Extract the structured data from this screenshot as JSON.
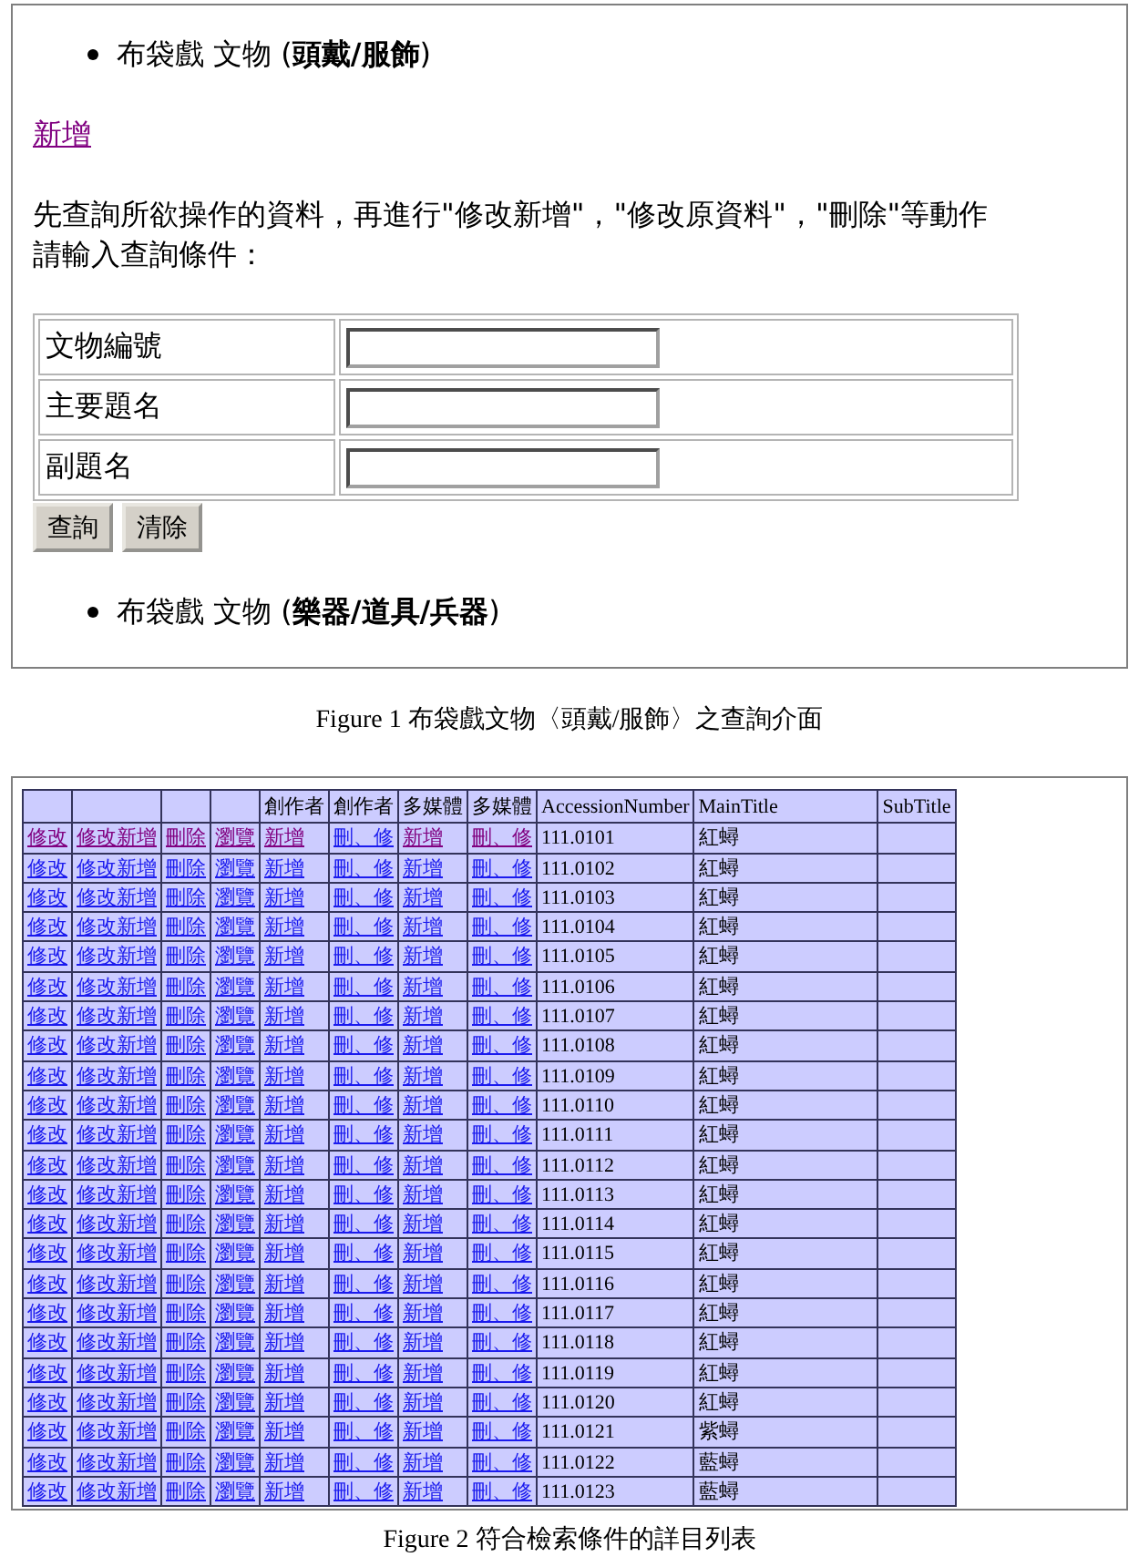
{
  "query_panel": {
    "heading": "布袋戲 文物 (**頭戴/服飾**)",
    "add_link": {
      "text": "新增",
      "visited": true
    },
    "instructions": [
      "先查詢所欲操作的資料，再進行\"修改新增\"，\"修改原資料\"，\"刪除\"等動作",
      "請輸入查詢條件："
    ],
    "fields": [
      {
        "label": "文物編號"
      },
      {
        "label": "主要題名"
      },
      {
        "label": "副題名"
      }
    ],
    "buttons": [
      "查詢",
      "清除"
    ],
    "next_heading": "布袋戲 文物 (**樂器/道具/兵器**)"
  },
  "caption_1": "Figure 1  布袋戲文物〈頭戴/服飾〉之查詢介面",
  "results_table": {
    "columns": [
      {
        "kind": "blank"
      },
      {
        "kind": "blank"
      },
      {
        "kind": "blank"
      },
      {
        "kind": "blank"
      },
      {
        "kind": "label",
        "label": "創作者"
      },
      {
        "kind": "label",
        "label": "創作者"
      },
      {
        "kind": "label",
        "label": "多媒體"
      },
      {
        "kind": "label",
        "label": "多媒體"
      },
      {
        "kind": "label",
        "label": "AccessionNumber"
      },
      {
        "kind": "label",
        "label": "MainTitle"
      },
      {
        "kind": "label",
        "label": "SubTitle"
      }
    ],
    "rows": [
      {
        "links": [
          {
            "text": "修改",
            "visited": true
          },
          {
            "text": "修改新增",
            "visited": true
          },
          {
            "text": "刪除",
            "visited": true
          },
          {
            "text": "瀏覽",
            "visited": true
          },
          {
            "text": "新增",
            "visited": true
          },
          {
            "text": "刪、修",
            "visited": false
          },
          {
            "text": "新增",
            "visited": true
          },
          {
            "text": "刪、修",
            "visited": true
          }
        ],
        "accession": "111.0101",
        "main_title": "紅蟳"
      },
      {
        "links": [
          {
            "text": "修改",
            "visited": false
          },
          {
            "text": "修改新增",
            "visited": false
          },
          {
            "text": "刪除",
            "visited": false
          },
          {
            "text": "瀏覽",
            "visited": false
          },
          {
            "text": "新增",
            "visited": false
          },
          {
            "text": "刪、修",
            "visited": false
          },
          {
            "text": "新增",
            "visited": false
          },
          {
            "text": "刪、修",
            "visited": false
          }
        ],
        "accession": "111.0102",
        "main_title": "紅蟳"
      },
      {
        "links": [
          {
            "text": "修改",
            "visited": false
          },
          {
            "text": "修改新增",
            "visited": false
          },
          {
            "text": "刪除",
            "visited": false
          },
          {
            "text": "瀏覽",
            "visited": false
          },
          {
            "text": "新增",
            "visited": false
          },
          {
            "text": "刪、修",
            "visited": false
          },
          {
            "text": "新增",
            "visited": false
          },
          {
            "text": "刪、修",
            "visited": false
          }
        ],
        "accession": "111.0103",
        "main_title": "紅蟳"
      },
      {
        "links": [
          {
            "text": "修改",
            "visited": false
          },
          {
            "text": "修改新增",
            "visited": false
          },
          {
            "text": "刪除",
            "visited": false
          },
          {
            "text": "瀏覽",
            "visited": false
          },
          {
            "text": "新增",
            "visited": false
          },
          {
            "text": "刪、修",
            "visited": false
          },
          {
            "text": "新增",
            "visited": false
          },
          {
            "text": "刪、修",
            "visited": false
          }
        ],
        "accession": "111.0104",
        "main_title": "紅蟳"
      },
      {
        "links": [
          {
            "text": "修改",
            "visited": false
          },
          {
            "text": "修改新增",
            "visited": false
          },
          {
            "text": "刪除",
            "visited": false
          },
          {
            "text": "瀏覽",
            "visited": false
          },
          {
            "text": "新增",
            "visited": false
          },
          {
            "text": "刪、修",
            "visited": false
          },
          {
            "text": "新增",
            "visited": false
          },
          {
            "text": "刪、修",
            "visited": false
          }
        ],
        "accession": "111.0105",
        "main_title": "紅蟳"
      },
      {
        "links": [
          {
            "text": "修改",
            "visited": false
          },
          {
            "text": "修改新增",
            "visited": false
          },
          {
            "text": "刪除",
            "visited": false
          },
          {
            "text": "瀏覽",
            "visited": false
          },
          {
            "text": "新增",
            "visited": false
          },
          {
            "text": "刪、修",
            "visited": false
          },
          {
            "text": "新增",
            "visited": false
          },
          {
            "text": "刪、修",
            "visited": false
          }
        ],
        "accession": "111.0106",
        "main_title": "紅蟳"
      },
      {
        "links": [
          {
            "text": "修改",
            "visited": false
          },
          {
            "text": "修改新增",
            "visited": false
          },
          {
            "text": "刪除",
            "visited": false
          },
          {
            "text": "瀏覽",
            "visited": false
          },
          {
            "text": "新增",
            "visited": false
          },
          {
            "text": "刪、修",
            "visited": false
          },
          {
            "text": "新增",
            "visited": false
          },
          {
            "text": "刪、修",
            "visited": false
          }
        ],
        "accession": "111.0107",
        "main_title": "紅蟳"
      },
      {
        "links": [
          {
            "text": "修改",
            "visited": false
          },
          {
            "text": "修改新增",
            "visited": false
          },
          {
            "text": "刪除",
            "visited": false
          },
          {
            "text": "瀏覽",
            "visited": false
          },
          {
            "text": "新增",
            "visited": false
          },
          {
            "text": "刪、修",
            "visited": false
          },
          {
            "text": "新增",
            "visited": false
          },
          {
            "text": "刪、修",
            "visited": false
          }
        ],
        "accession": "111.0108",
        "main_title": "紅蟳"
      },
      {
        "links": [
          {
            "text": "修改",
            "visited": false
          },
          {
            "text": "修改新增",
            "visited": false
          },
          {
            "text": "刪除",
            "visited": false
          },
          {
            "text": "瀏覽",
            "visited": false
          },
          {
            "text": "新增",
            "visited": false
          },
          {
            "text": "刪、修",
            "visited": false
          },
          {
            "text": "新增",
            "visited": false
          },
          {
            "text": "刪、修",
            "visited": false
          }
        ],
        "accession": "111.0109",
        "main_title": "紅蟳"
      },
      {
        "links": [
          {
            "text": "修改",
            "visited": false
          },
          {
            "text": "修改新增",
            "visited": false
          },
          {
            "text": "刪除",
            "visited": false
          },
          {
            "text": "瀏覽",
            "visited": false
          },
          {
            "text": "新增",
            "visited": false
          },
          {
            "text": "刪、修",
            "visited": false
          },
          {
            "text": "新增",
            "visited": false
          },
          {
            "text": "刪、修",
            "visited": false
          }
        ],
        "accession": "111.0110",
        "main_title": "紅蟳"
      },
      {
        "links": [
          {
            "text": "修改",
            "visited": false
          },
          {
            "text": "修改新增",
            "visited": false
          },
          {
            "text": "刪除",
            "visited": false
          },
          {
            "text": "瀏覽",
            "visited": false
          },
          {
            "text": "新增",
            "visited": false
          },
          {
            "text": "刪、修",
            "visited": false
          },
          {
            "text": "新增",
            "visited": false
          },
          {
            "text": "刪、修",
            "visited": false
          }
        ],
        "accession": "111.0111",
        "main_title": "紅蟳"
      },
      {
        "links": [
          {
            "text": "修改",
            "visited": false
          },
          {
            "text": "修改新增",
            "visited": false
          },
          {
            "text": "刪除",
            "visited": false
          },
          {
            "text": "瀏覽",
            "visited": false
          },
          {
            "text": "新增",
            "visited": false
          },
          {
            "text": "刪、修",
            "visited": false
          },
          {
            "text": "新增",
            "visited": false
          },
          {
            "text": "刪、修",
            "visited": false
          }
        ],
        "accession": "111.0112",
        "main_title": "紅蟳"
      },
      {
        "links": [
          {
            "text": "修改",
            "visited": false
          },
          {
            "text": "修改新增",
            "visited": false
          },
          {
            "text": "刪除",
            "visited": false
          },
          {
            "text": "瀏覽",
            "visited": false
          },
          {
            "text": "新增",
            "visited": false
          },
          {
            "text": "刪、修",
            "visited": false
          },
          {
            "text": "新增",
            "visited": false
          },
          {
            "text": "刪、修",
            "visited": false
          }
        ],
        "accession": "111.0113",
        "main_title": "紅蟳"
      },
      {
        "links": [
          {
            "text": "修改",
            "visited": false
          },
          {
            "text": "修改新增",
            "visited": false
          },
          {
            "text": "刪除",
            "visited": false
          },
          {
            "text": "瀏覽",
            "visited": false
          },
          {
            "text": "新增",
            "visited": false
          },
          {
            "text": "刪、修",
            "visited": false
          },
          {
            "text": "新增",
            "visited": false
          },
          {
            "text": "刪、修",
            "visited": false
          }
        ],
        "accession": "111.0114",
        "main_title": "紅蟳"
      },
      {
        "links": [
          {
            "text": "修改",
            "visited": false
          },
          {
            "text": "修改新增",
            "visited": false
          },
          {
            "text": "刪除",
            "visited": false
          },
          {
            "text": "瀏覽",
            "visited": false
          },
          {
            "text": "新增",
            "visited": false
          },
          {
            "text": "刪、修",
            "visited": false
          },
          {
            "text": "新增",
            "visited": false
          },
          {
            "text": "刪、修",
            "visited": false
          }
        ],
        "accession": "111.0115",
        "main_title": "紅蟳"
      },
      {
        "links": [
          {
            "text": "修改",
            "visited": false
          },
          {
            "text": "修改新增",
            "visited": false
          },
          {
            "text": "刪除",
            "visited": false
          },
          {
            "text": "瀏覽",
            "visited": false
          },
          {
            "text": "新增",
            "visited": false
          },
          {
            "text": "刪、修",
            "visited": false
          },
          {
            "text": "新增",
            "visited": false
          },
          {
            "text": "刪、修",
            "visited": false
          }
        ],
        "accession": "111.0116",
        "main_title": "紅蟳"
      },
      {
        "links": [
          {
            "text": "修改",
            "visited": false
          },
          {
            "text": "修改新增",
            "visited": false
          },
          {
            "text": "刪除",
            "visited": false
          },
          {
            "text": "瀏覽",
            "visited": false
          },
          {
            "text": "新增",
            "visited": false
          },
          {
            "text": "刪、修",
            "visited": false
          },
          {
            "text": "新增",
            "visited": false
          },
          {
            "text": "刪、修",
            "visited": false
          }
        ],
        "accession": "111.0117",
        "main_title": "紅蟳"
      },
      {
        "links": [
          {
            "text": "修改",
            "visited": false
          },
          {
            "text": "修改新增",
            "visited": false
          },
          {
            "text": "刪除",
            "visited": false
          },
          {
            "text": "瀏覽",
            "visited": false
          },
          {
            "text": "新增",
            "visited": false
          },
          {
            "text": "刪、修",
            "visited": false
          },
          {
            "text": "新增",
            "visited": false
          },
          {
            "text": "刪、修",
            "visited": false
          }
        ],
        "accession": "111.0118",
        "main_title": "紅蟳"
      },
      {
        "links": [
          {
            "text": "修改",
            "visited": false
          },
          {
            "text": "修改新增",
            "visited": false
          },
          {
            "text": "刪除",
            "visited": false
          },
          {
            "text": "瀏覽",
            "visited": false
          },
          {
            "text": "新增",
            "visited": false
          },
          {
            "text": "刪、修",
            "visited": false
          },
          {
            "text": "新增",
            "visited": false
          },
          {
            "text": "刪、修",
            "visited": false
          }
        ],
        "accession": "111.0119",
        "main_title": "紅蟳"
      },
      {
        "links": [
          {
            "text": "修改",
            "visited": false
          },
          {
            "text": "修改新增",
            "visited": false
          },
          {
            "text": "刪除",
            "visited": false
          },
          {
            "text": "瀏覽",
            "visited": false
          },
          {
            "text": "新增",
            "visited": false
          },
          {
            "text": "刪、修",
            "visited": false
          },
          {
            "text": "新增",
            "visited": false
          },
          {
            "text": "刪、修",
            "visited": false
          }
        ],
        "accession": "111.0120",
        "main_title": "紅蟳"
      },
      {
        "links": [
          {
            "text": "修改",
            "visited": false
          },
          {
            "text": "修改新增",
            "visited": false
          },
          {
            "text": "刪除",
            "visited": false
          },
          {
            "text": "瀏覽",
            "visited": false
          },
          {
            "text": "新增",
            "visited": false
          },
          {
            "text": "刪、修",
            "visited": false
          },
          {
            "text": "新增",
            "visited": false
          },
          {
            "text": "刪、修",
            "visited": false
          }
        ],
        "accession": "111.0121",
        "main_title": "紫蟳"
      },
      {
        "links": [
          {
            "text": "修改",
            "visited": false
          },
          {
            "text": "修改新增",
            "visited": false
          },
          {
            "text": "刪除",
            "visited": false
          },
          {
            "text": "瀏覽",
            "visited": false
          },
          {
            "text": "新增",
            "visited": false
          },
          {
            "text": "刪、修",
            "visited": false
          },
          {
            "text": "新增",
            "visited": false
          },
          {
            "text": "刪、修",
            "visited": false
          }
        ],
        "accession": "111.0122",
        "main_title": "藍蟳"
      },
      {
        "links": [
          {
            "text": "修改",
            "visited": false
          },
          {
            "text": "修改新增",
            "visited": false
          },
          {
            "text": "刪除",
            "visited": false
          },
          {
            "text": "瀏覽",
            "visited": false
          },
          {
            "text": "新增",
            "visited": false
          },
          {
            "text": "刪、修",
            "visited": false
          },
          {
            "text": "新增",
            "visited": false
          },
          {
            "text": "刪、修",
            "visited": false
          }
        ],
        "accession": "111.0123",
        "main_title": "藍蟳"
      }
    ]
  },
  "caption_2": "Figure 2  符合檢索條件的詳目列表"
}
